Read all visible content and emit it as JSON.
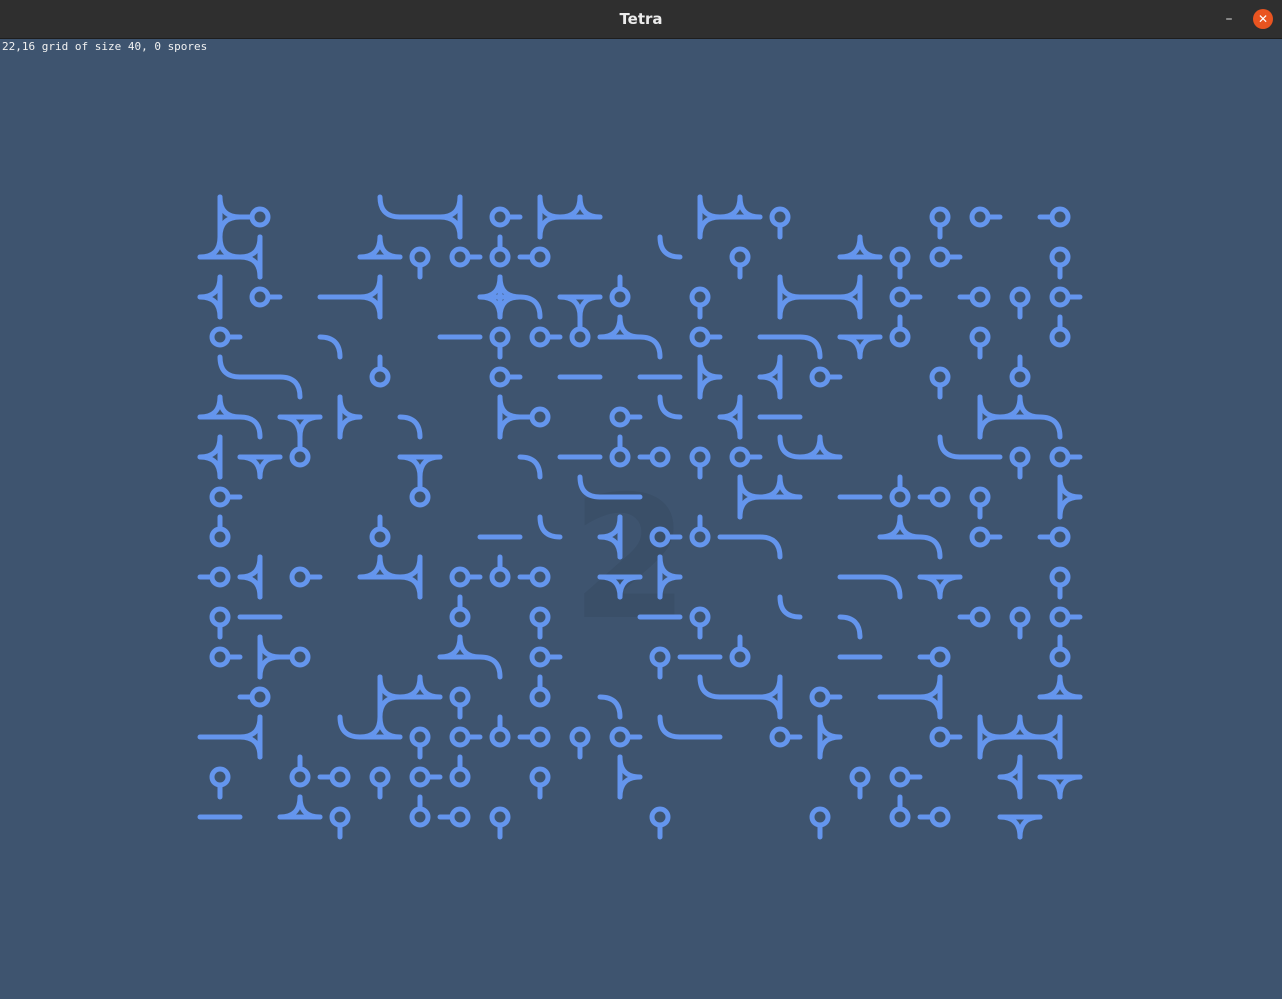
{
  "window": {
    "title": "Tetra",
    "minimize_label": "–",
    "close_label": "✕"
  },
  "status_text": "22,16 grid of size 40, 0 spores",
  "watermark_text": "2",
  "colors": {
    "background": "#3e546f",
    "tile": "#6495ed",
    "titlebar": "#2f2f2f",
    "close": "#e95420"
  },
  "game": {
    "cols": 22,
    "rows": 16,
    "cell_size": 40,
    "spores": 0,
    "tiles": [
      "3100223133003310001101",
      "3300311110020100311001",
      "3102300423101032310111",
      "1002002111321022310101",
      "2220100102023031001010",
      "3233020310120320000332",
      "3310030022111123002211",
      "1000010002200330211103",
      "1000100220311220032101",
      "1310331110330000223001",
      "1200001010021020200111",
      "1310003210012100201001",
      "0100331010202231023003",
      "2302311111122013001333",
      "1011111010300000110033",
      "2031011100010001011030"
    ]
  }
}
